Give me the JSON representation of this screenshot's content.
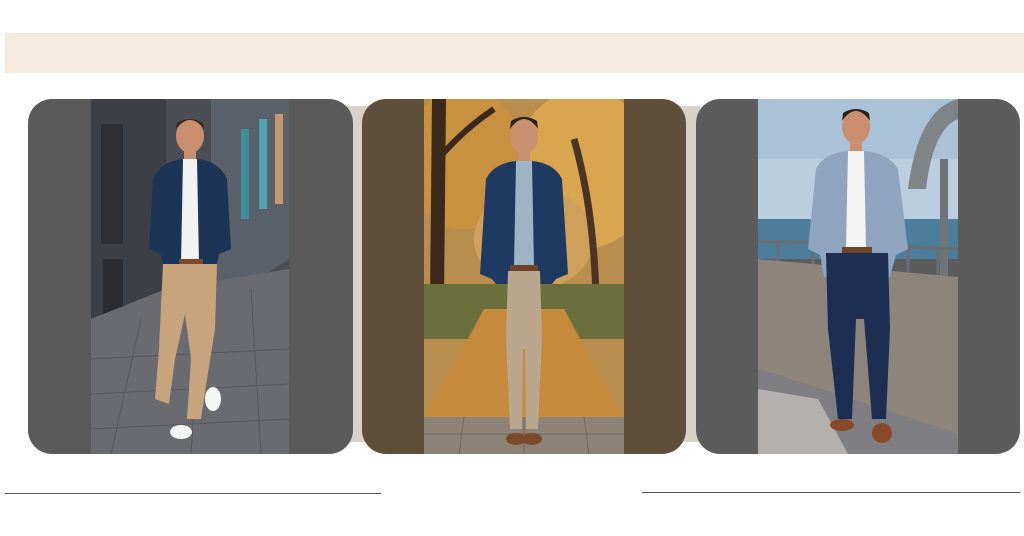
{
  "colors": {
    "banner": "#f5ebdf",
    "card_gray": "#5a5a5a",
    "card_brown": "#5e4e3a",
    "divider": "#555555"
  },
  "cards": [
    {
      "name": "navy-blazer-khaki-pants-street"
    },
    {
      "name": "navy-blazer-beige-trousers-autumn"
    },
    {
      "name": "grey-blazer-navy-trousers-seaside"
    }
  ]
}
